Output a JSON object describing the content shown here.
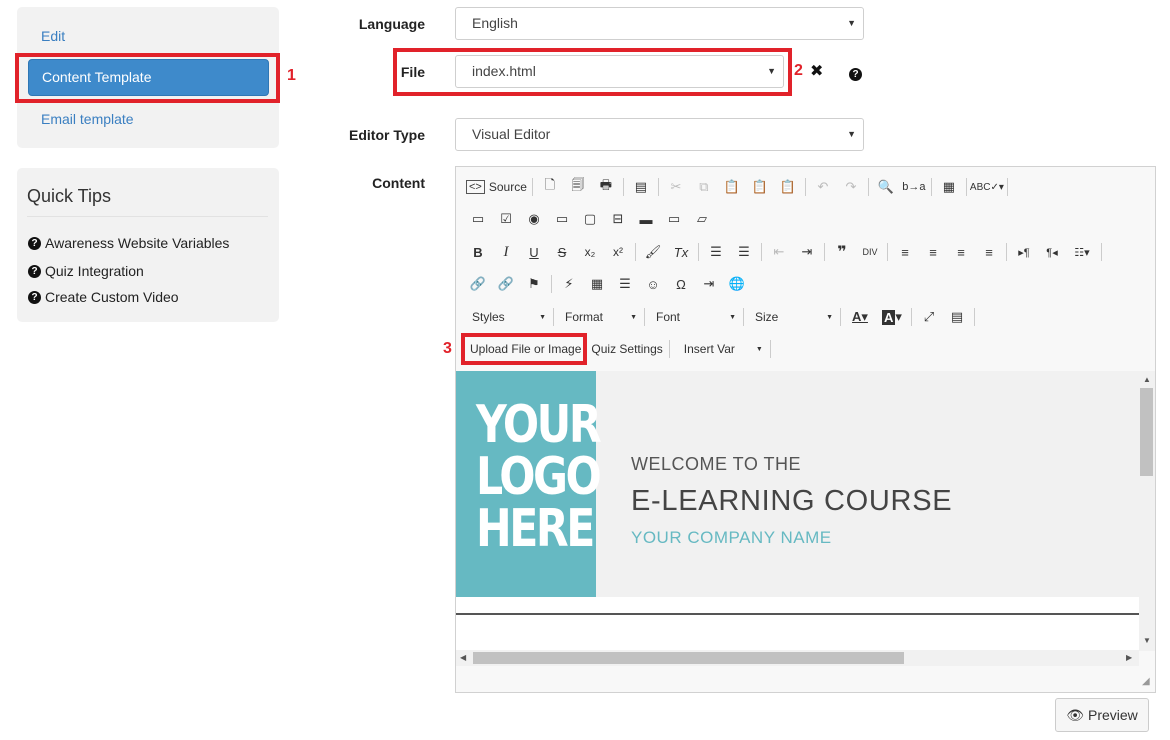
{
  "sidebar": {
    "links": [
      {
        "label": "Edit"
      },
      {
        "label": "Content Template",
        "active": true
      },
      {
        "label": "Email template"
      }
    ],
    "quick_tips": {
      "title": "Quick Tips",
      "items": [
        {
          "label": "Awareness Website Variables",
          "icon": "question-circle-icon"
        },
        {
          "label": "Quiz Integration",
          "icon": "question-circle-icon"
        },
        {
          "label": "Create Custom Video",
          "icon": "question-circle-icon"
        }
      ]
    }
  },
  "annotations": {
    "one": "1",
    "two": "2",
    "three": "3",
    "color": "#e1222a"
  },
  "form": {
    "language": {
      "label": "Language",
      "value": "English"
    },
    "file": {
      "label": "File",
      "value": "index.html"
    },
    "editor_type": {
      "label": "Editor Type",
      "value": "Visual Editor"
    },
    "content": {
      "label": "Content"
    }
  },
  "toolbar": {
    "source_label": "Source",
    "styles_label": "Styles",
    "format_label": "Format",
    "font_label": "Font",
    "size_label": "Size",
    "upload_label": "Upload File or Image",
    "quiz_label": "Quiz Settings",
    "insert_var_label": "Insert Var"
  },
  "banner": {
    "logo_line1": "YOUR",
    "logo_line2": "LOGO",
    "logo_line3": "HERE",
    "welcome": "WELCOME TO THE",
    "course": "E-LEARNING COURSE",
    "company": "YOUR COMPANY NAME",
    "accent_color": "#66b9c2"
  },
  "preview_button": {
    "label": "Preview"
  },
  "colors": {
    "primary": "#3e8acb",
    "link": "#3a7fc1",
    "highlight": "#e1222a"
  }
}
